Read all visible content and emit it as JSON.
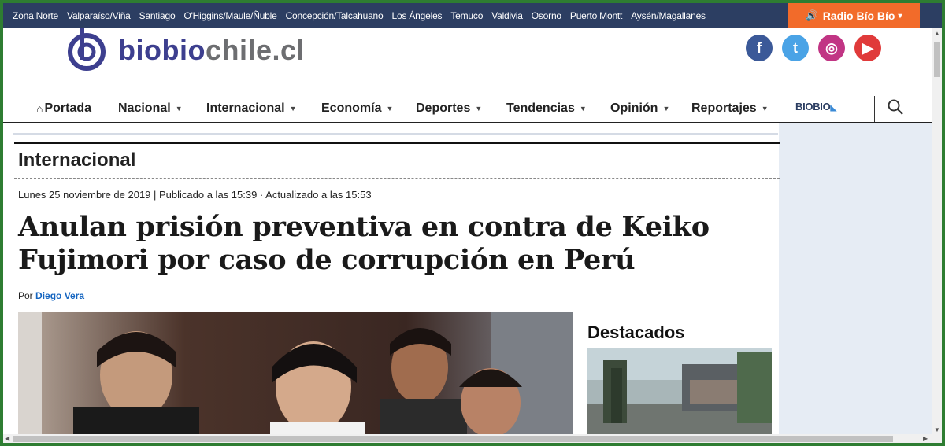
{
  "top_bar": {
    "regions": [
      "Zona Norte",
      "Valparaíso/Viña",
      "Santiago",
      "O'Higgins/Maule/Ñuble",
      "Concepción/Talcahuano",
      "Los Ángeles",
      "Temuco",
      "Valdivia",
      "Osorno",
      "Puerto Montt",
      "Aysén/Magallanes"
    ],
    "radio_label": "Radio Bío Bío"
  },
  "header": {
    "logo_part1": "biobio",
    "logo_part2": "chile.cl",
    "social": [
      {
        "name": "facebook",
        "glyph": "f",
        "color": "#3b5998"
      },
      {
        "name": "twitter",
        "glyph": "t",
        "color": "#4aa3e6"
      },
      {
        "name": "instagram",
        "glyph": "◎",
        "color": "#c13584"
      },
      {
        "name": "youtube",
        "glyph": "▶",
        "color": "#e03a3a"
      }
    ]
  },
  "nav": {
    "items": [
      {
        "label": "Portada",
        "dropdown": false
      },
      {
        "label": "Nacional",
        "dropdown": true
      },
      {
        "label": "Internacional",
        "dropdown": true
      },
      {
        "label": "Economía",
        "dropdown": true
      },
      {
        "label": "Deportes",
        "dropdown": true
      },
      {
        "label": "Tendencias",
        "dropdown": true
      },
      {
        "label": "Opinión",
        "dropdown": true
      },
      {
        "label": "Reportajes",
        "dropdown": true
      }
    ],
    "brand": "BIOBIO"
  },
  "article": {
    "section": "Internacional",
    "date": "Lunes 25 noviembre de 2019 | Publicado a las 15:39 · Actualizado a las 15:53",
    "title": "Anulan prisión preventiva en contra de Keiko Fujimori por caso de corrupción en Perú",
    "author_prefix": "Por",
    "author": "Diego Vera"
  },
  "sidebar": {
    "destacados_title": "Destacados"
  },
  "colors": {
    "topbar": "#2c3e62",
    "radio": "#f26b2a",
    "brand": "#3d3f8f",
    "link": "#1565c0"
  }
}
